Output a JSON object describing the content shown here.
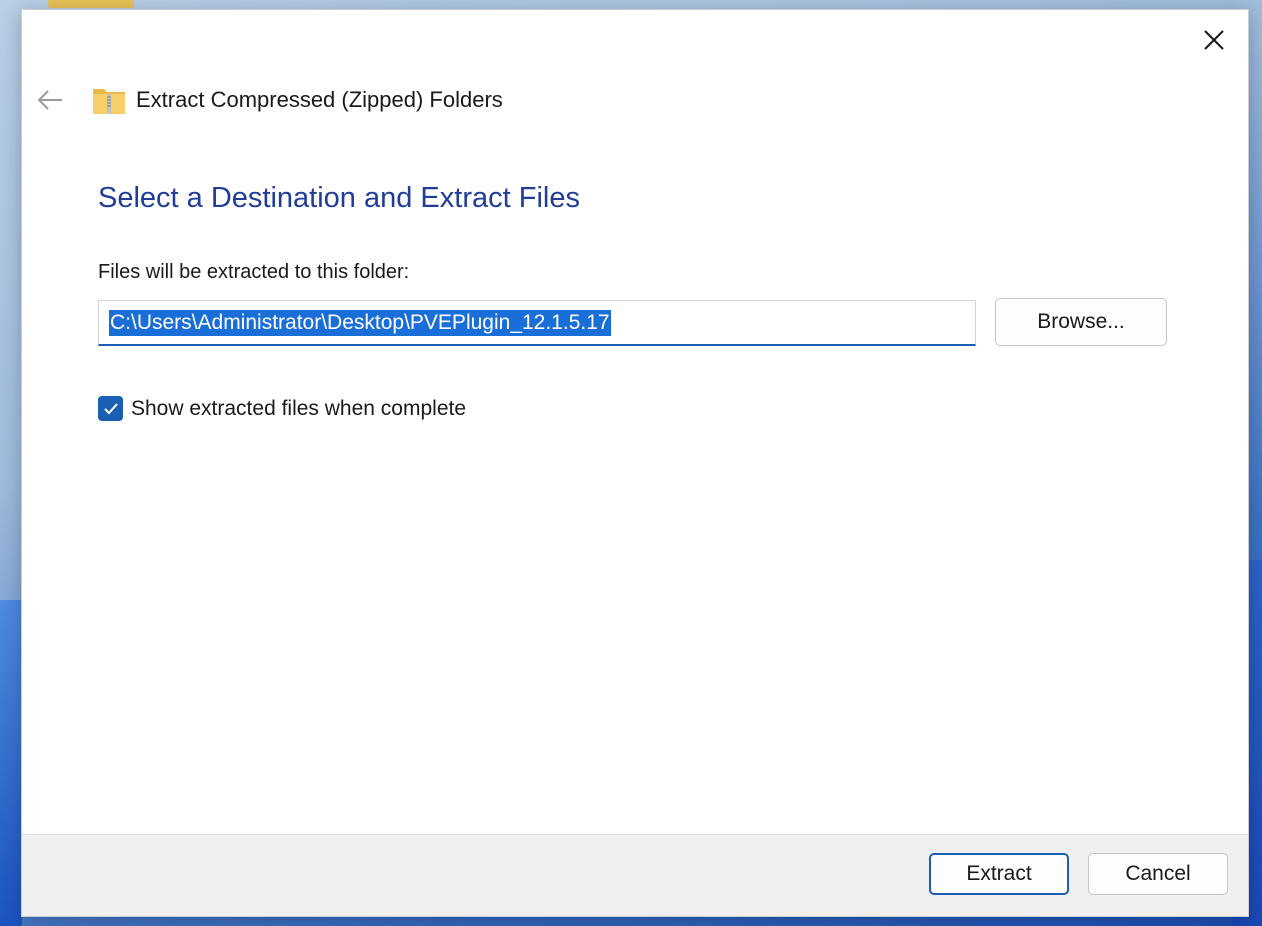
{
  "window": {
    "title": "Extract Compressed (Zipped) Folders",
    "close_icon": "close-icon",
    "back_icon": "back-arrow-icon",
    "app_icon": "zip-folder-icon"
  },
  "main": {
    "heading": "Select a Destination and Extract Files",
    "destination_label": "Files will be extracted to this folder:",
    "destination_value": "C:\\Users\\Administrator\\Desktop\\PVEPlugin_12.1.5.17",
    "browse_label": "Browse...",
    "show_files_checked": true,
    "show_files_label": "Show extracted files when complete"
  },
  "footer": {
    "extract_label": "Extract",
    "cancel_label": "Cancel"
  },
  "colors": {
    "heading": "#1f3d99",
    "accent": "#1a5fb4",
    "selection": "#1a6ed8"
  }
}
